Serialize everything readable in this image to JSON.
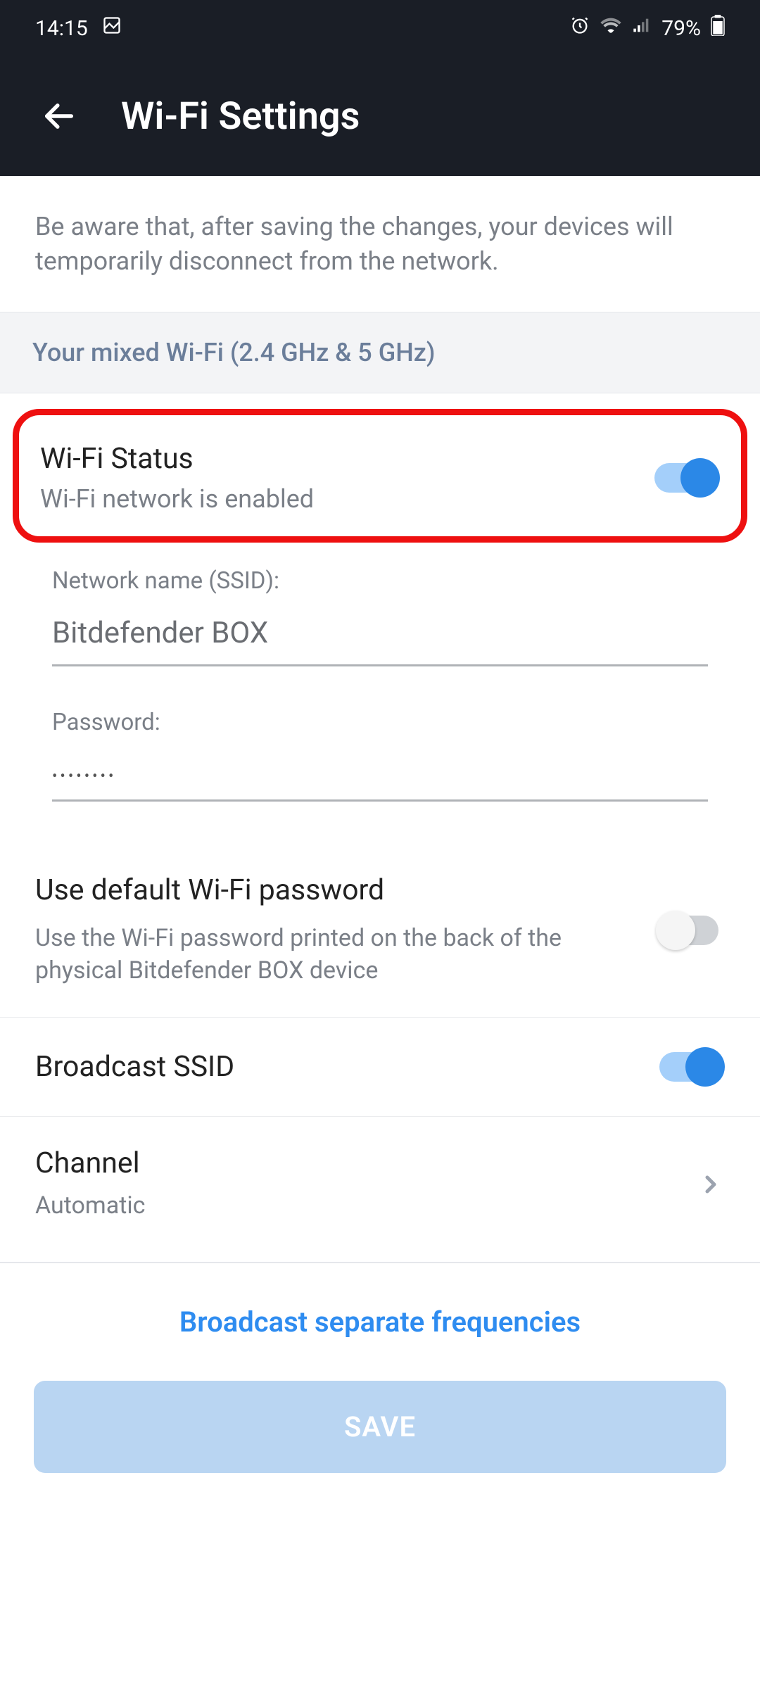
{
  "statusBar": {
    "time": "14:15",
    "battery": "79%"
  },
  "appBar": {
    "title": "Wi-Fi Settings"
  },
  "warning": "Be aware that, after saving the changes, your devices will temporarily disconnect from the network.",
  "sectionHeader": "Your mixed Wi-Fi (2.4 GHz & 5 GHz)",
  "wifiStatus": {
    "title": "Wi-Fi Status",
    "subtitle": "Wi-Fi network is enabled",
    "enabled": true
  },
  "ssid": {
    "label": "Network name (SSID):",
    "value": "Bitdefender BOX"
  },
  "password": {
    "label": "Password:",
    "value": "••••••••"
  },
  "defaultPassword": {
    "title": "Use default Wi-Fi password",
    "subtitle": "Use the Wi-Fi password printed on the back of the physical Bitdefender BOX device",
    "enabled": false
  },
  "broadcastSsid": {
    "title": "Broadcast SSID",
    "enabled": true
  },
  "channel": {
    "title": "Channel",
    "value": "Automatic"
  },
  "linkButton": "Broadcast separate frequencies",
  "saveButton": "SAVE"
}
